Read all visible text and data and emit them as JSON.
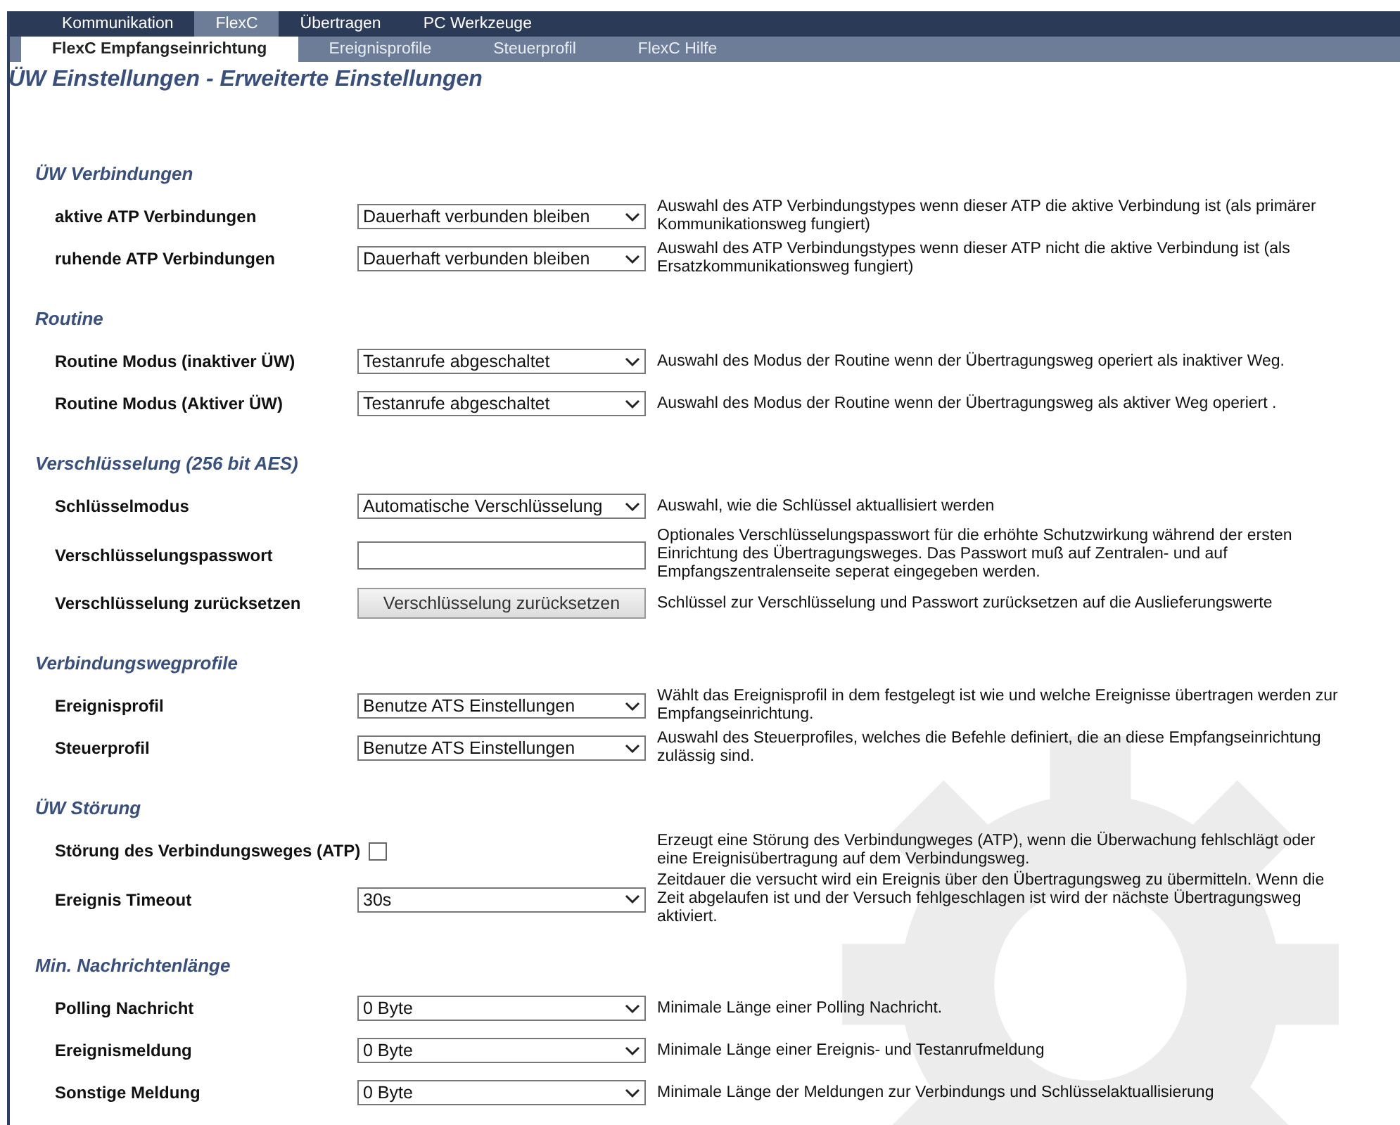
{
  "main_tabs": [
    {
      "label": "Kommunikation",
      "selected": false
    },
    {
      "label": "FlexC",
      "selected": true
    },
    {
      "label": "Übertragen",
      "selected": false
    },
    {
      "label": "PC Werkzeuge",
      "selected": false
    }
  ],
  "sub_tabs": [
    {
      "label": "FlexC Empfangseinrichtung",
      "selected": true
    },
    {
      "label": "Ereignisprofile",
      "selected": false
    },
    {
      "label": "Steuerprofil",
      "selected": false
    },
    {
      "label": "FlexC Hilfe",
      "selected": false
    }
  ],
  "page_title": "ÜW Einstellungen - Erweiterte Einstellungen",
  "sections": [
    {
      "title": "ÜW Verbindungen",
      "rows": [
        {
          "kind": "select",
          "label": "aktive ATP Verbindungen",
          "value": "Dauerhaft verbunden bleiben",
          "description": "Auswahl des ATP Verbindungstypes wenn dieser ATP die aktive Verbindung ist (als primärer Kommunikationsweg fungiert)"
        },
        {
          "kind": "select",
          "label": "ruhende ATP Verbindungen",
          "value": "Dauerhaft verbunden bleiben",
          "description": "Auswahl des ATP Verbindungstypes wenn dieser ATP nicht die aktive Verbindung ist (als Ersatzkommunikationsweg fungiert)"
        }
      ]
    },
    {
      "title": "Routine",
      "rows": [
        {
          "kind": "select",
          "label": "Routine Modus (inaktiver ÜW)",
          "value": "Testanrufe abgeschaltet",
          "description": "Auswahl des Modus der Routine wenn der Übertragungsweg operiert als inaktiver Weg."
        },
        {
          "kind": "select",
          "label": "Routine Modus (Aktiver ÜW)",
          "value": "Testanrufe abgeschaltet",
          "description": "Auswahl des Modus der Routine wenn der Übertragungsweg als aktiver Weg operiert ."
        }
      ]
    },
    {
      "title": "Verschlüsselung (256 bit AES)",
      "rows": [
        {
          "kind": "select",
          "label": "Schlüsselmodus",
          "value": "Automatische Verschlüsselung",
          "description": "Auswahl, wie die Schlüssel aktuallisiert werden"
        },
        {
          "kind": "text",
          "label": "Verschlüsselungspasswort",
          "description": "Optionales Verschlüsselungspasswort für die erhöhte Schutzwirkung während der ersten Einrichtung des Übertragungsweges. Das Passwort muß auf Zentralen- und auf Empfangszentralenseite seperat eingegeben werden."
        },
        {
          "kind": "button",
          "label": "Verschlüsselung zurücksetzen",
          "value": "Verschlüsselung zurücksetzen",
          "description": "Schlüssel zur Verschlüsselung und Passwort zurücksetzen auf die Auslieferungswerte"
        }
      ]
    },
    {
      "title": "Verbindungswegprofile",
      "rows": [
        {
          "kind": "select",
          "label": "Ereignisprofil",
          "value": "Benutze ATS Einstellungen",
          "description": "Wählt das Ereignisprofil in dem festgelegt ist wie und welche Ereignisse übertragen werden zur Empfangseinrichtung."
        },
        {
          "kind": "select",
          "label": "Steuerprofil",
          "value": "Benutze ATS Einstellungen",
          "description": "Auswahl des Steuerprofiles, welches die Befehle definiert, die an diese Empfangseinrichtung zulässig sind."
        }
      ]
    },
    {
      "title": "ÜW Störung",
      "rows": [
        {
          "kind": "checkbox",
          "label": "Störung des Verbindungsweges (ATP)",
          "checked": false,
          "description": "Erzeugt eine Störung des Verbindungweges (ATP), wenn die Überwachung fehlschlägt oder eine Ereignisübertragung auf dem Verbindungsweg."
        },
        {
          "kind": "select",
          "label": "Ereignis Timeout",
          "value": "30s",
          "description": "Zeitdauer die versucht wird ein Ereignis über den Übertragungsweg zu übermitteln. Wenn die Zeit abgelaufen ist und der Versuch fehlgeschlagen ist wird der nächste Übertragungsweg aktiviert."
        }
      ]
    },
    {
      "title": "Min. Nachrichtenlänge",
      "rows": [
        {
          "kind": "select",
          "label": "Polling Nachricht",
          "value": "0 Byte",
          "description": "Minimale Länge einer Polling Nachricht."
        },
        {
          "kind": "select",
          "label": "Ereignismeldung",
          "value": "0 Byte",
          "description": "Minimale Länge einer Ereignis- und Testanrufmeldung"
        },
        {
          "kind": "select",
          "label": "Sonstige Meldung",
          "value": "0 Byte",
          "description": "Minimale Länge der Meldungen zur Verbindungs und Schlüsselaktuallisierung"
        }
      ]
    }
  ]
}
